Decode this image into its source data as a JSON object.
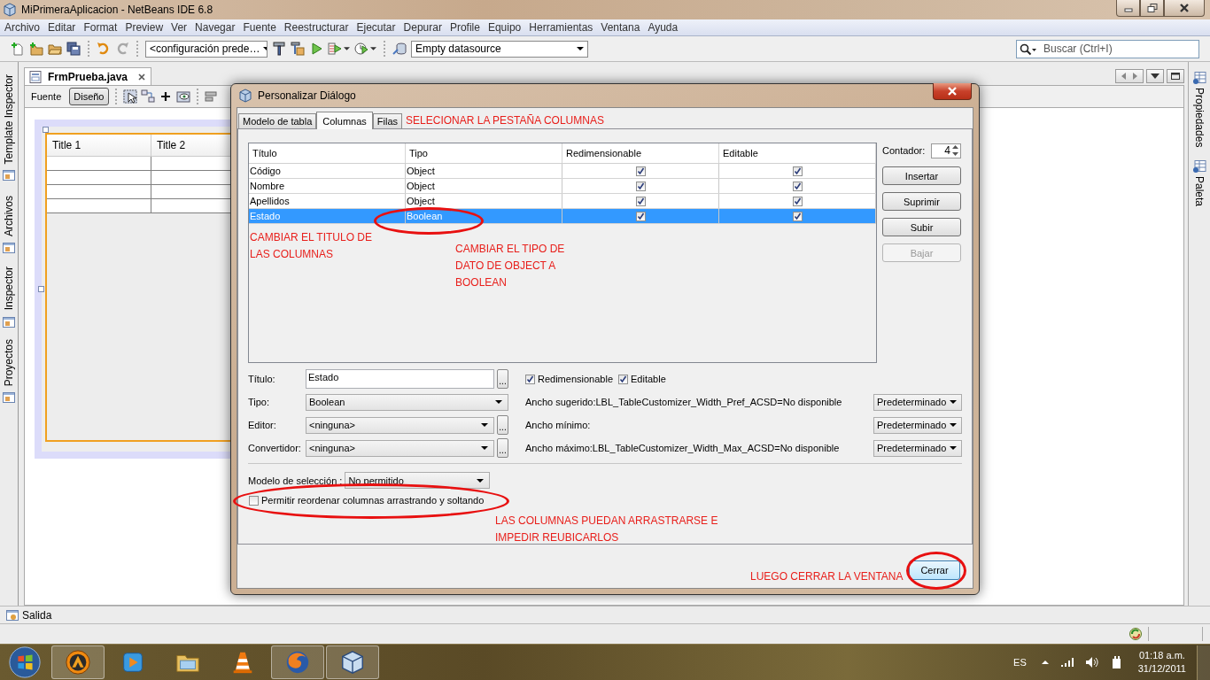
{
  "window": {
    "title": "MiPrimeraAplicacion - NetBeans IDE 6.8"
  },
  "menu": [
    "Archivo",
    "Editar",
    "Format",
    "Preview",
    "Ver",
    "Navegar",
    "Fuente",
    "Reestructurar",
    "Ejecutar",
    "Depurar",
    "Profile",
    "Equipo",
    "Herramientas",
    "Ventana",
    "Ayuda"
  ],
  "toolbar": {
    "configuration": "<configuración prede…",
    "datasource": "Empty datasource",
    "search": {
      "placeholder": "Buscar (Ctrl+I)"
    }
  },
  "left_tabs": [
    "Template Inspector",
    "Archivos",
    "Inspector",
    "Proyectos"
  ],
  "right_tabs": [
    "Propiedades",
    "Paleta"
  ],
  "editor": {
    "tabs": [
      {
        "label": "FrmPrueba.java",
        "selected": true
      }
    ],
    "views": [
      {
        "label": "Fuente",
        "selected": false
      },
      {
        "label": "Diseño",
        "selected": true
      }
    ],
    "table_columns": [
      "Title 1",
      "Title 2"
    ]
  },
  "output_tab": "Salida",
  "dialog": {
    "title": "Personalizar Diálogo",
    "tabs": [
      {
        "label": "Modelo de tabla",
        "selected": false
      },
      {
        "label": "Columnas",
        "selected": true
      },
      {
        "label": "Filas",
        "selected": false
      }
    ],
    "columns_table": {
      "columns": [
        "Título",
        "Tipo",
        "Redimensionable",
        "Editable"
      ],
      "rows": [
        {
          "title": "Código",
          "type": "Object",
          "resizable": true,
          "editable": true,
          "selected": false
        },
        {
          "title": "Nombre",
          "type": "Object",
          "resizable": true,
          "editable": true,
          "selected": false
        },
        {
          "title": "Apellidos",
          "type": "Object",
          "resizable": true,
          "editable": true,
          "selected": false
        },
        {
          "title": "Estado",
          "type": "Boolean",
          "resizable": true,
          "editable": true,
          "selected": true
        }
      ]
    },
    "counter": {
      "label": "Contador:",
      "value": "4"
    },
    "buttons": [
      {
        "label": "Insertar",
        "disabled": false
      },
      {
        "label": "Suprimir",
        "disabled": false
      },
      {
        "label": "Subir",
        "disabled": false
      },
      {
        "label": "Bajar",
        "disabled": true
      }
    ],
    "fields": [
      {
        "label": "Título:",
        "kind": "text",
        "value": "Estado",
        "browse": "..."
      },
      {
        "label": "Tipo:",
        "kind": "select",
        "value": "Boolean"
      },
      {
        "label": "Editor:",
        "kind": "select",
        "value": "<ninguna>",
        "browse": "..."
      },
      {
        "label": "Convertidor:",
        "kind": "select",
        "value": "<ninguna>",
        "browse": "..."
      }
    ],
    "flags": [
      {
        "label": "Redimensionable",
        "checked": true
      },
      {
        "label": "Editable",
        "checked": true
      }
    ],
    "widths": [
      {
        "label": "Ancho sugerido:LBL_TableCustomizer_Width_Pref_ACSD=No disponible",
        "value": "Predeterminado"
      },
      {
        "label": "Ancho mínimo:",
        "value": "Predeterminado"
      },
      {
        "label": "Ancho máximo:LBL_TableCustomizer_Width_Max_ACSD=No disponible",
        "value": "Predeterminado"
      }
    ],
    "selection_model": {
      "label": "Modelo de selección :",
      "value": "No permitido"
    },
    "reorder": {
      "label": "Permitir reordenar columnas arrastrando y soltando",
      "checked": false
    },
    "close_button": "Cerrar"
  },
  "annotations": [
    {
      "lines": [
        "SELECIONAR LA PESTAÑA COLUMNAS"
      ]
    },
    {
      "lines": [
        "CAMBIAR EL TITULO DE",
        "LAS COLUMNAS"
      ]
    },
    {
      "lines": [
        "CAMBIAR EL TIPO DE",
        "DATO DE OBJECT A",
        "BOOLEAN"
      ]
    },
    {
      "lines": [
        "LAS COLUMNAS PUEDAN ARRASTRARSE E",
        "IMPEDIR REUBICARLOS"
      ]
    },
    {
      "lines": [
        "LUEGO CERRAR LA VENTANA"
      ]
    }
  ],
  "taskbar": {
    "apps": [
      {
        "kind": "a-circle",
        "running": true
      },
      {
        "kind": "media",
        "running": false
      },
      {
        "kind": "folder",
        "running": false
      },
      {
        "kind": "cone",
        "running": false
      },
      {
        "kind": "browser",
        "running": true
      },
      {
        "kind": "cube",
        "running": true
      }
    ],
    "language": "ES",
    "time": "01:18 a.m.",
    "date": "31/12/2011"
  }
}
